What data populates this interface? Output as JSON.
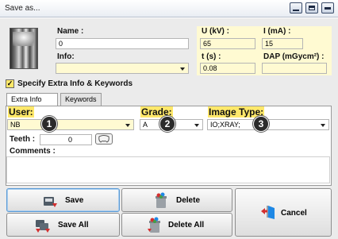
{
  "window": {
    "title": "Save as..."
  },
  "patient": {
    "name_label": "Name :",
    "name_value": "0",
    "info_label": "Info:",
    "info_value": ""
  },
  "exposure": {
    "u_label": "U (kV) :",
    "u_value": "65",
    "i_label": "I (mA) :",
    "i_value": "15",
    "t_label": "t (s) :",
    "t_value": "0.08",
    "dap_label": "DAP (mGycm²) :",
    "dap_value": ""
  },
  "extra": {
    "checkbox_label": "Specify Extra Info & Keywords",
    "checked": true
  },
  "tabs": [
    {
      "label": "Extra Info",
      "active": true
    },
    {
      "label": "Keywords",
      "active": false
    }
  ],
  "extra_info": {
    "user_label": "User:",
    "user_value": "NB",
    "grade_label": "Grade:",
    "grade_value": "A",
    "image_type_label": "Image Type:",
    "image_type_value": "IO;XRAY;",
    "teeth_label": "Teeth :",
    "teeth_value": "0",
    "comments_label": "Comments :"
  },
  "badges": [
    "1",
    "2",
    "3"
  ],
  "buttons": {
    "save": "Save",
    "save_all": "Save All",
    "delete": "Delete",
    "delete_all": "Delete All",
    "cancel": "Cancel"
  },
  "colors": {
    "highlight_yellow": "#fffad2",
    "label_yellow": "#ffe86a",
    "badge_dark": "#2b2b2b"
  }
}
